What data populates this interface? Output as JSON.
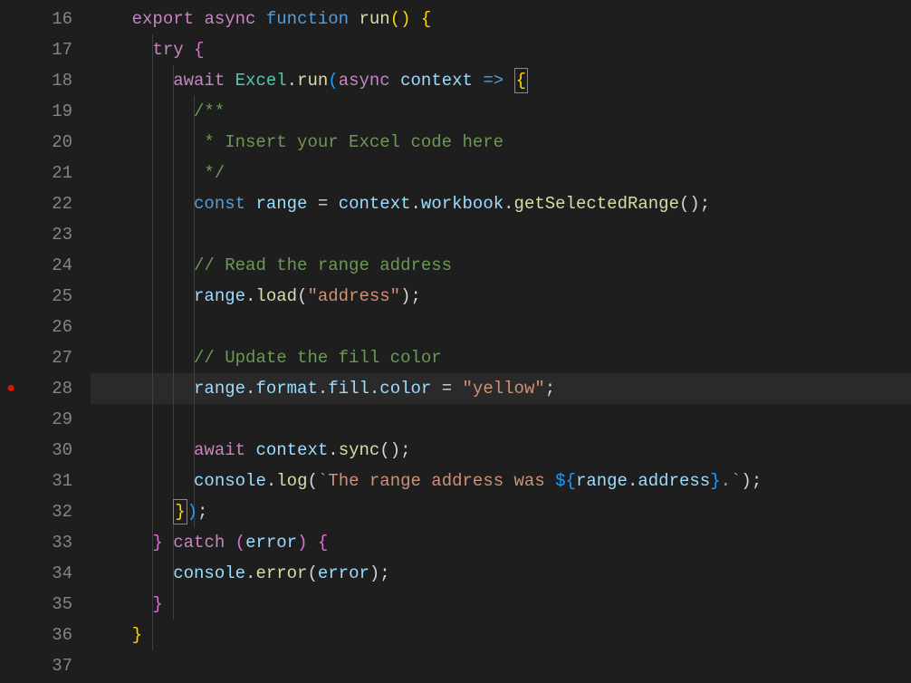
{
  "editor": {
    "startLine": 16,
    "endLine": 37,
    "breakpointLines": [
      28
    ],
    "currentLine": 28,
    "lines": [
      {
        "n": 16,
        "tokens": [
          {
            "t": "    ",
            "c": ""
          },
          {
            "t": "export",
            "c": "k-export"
          },
          {
            "t": " ",
            "c": ""
          },
          {
            "t": "async",
            "c": "k-async"
          },
          {
            "t": " ",
            "c": ""
          },
          {
            "t": "function",
            "c": "k-function"
          },
          {
            "t": " ",
            "c": ""
          },
          {
            "t": "run",
            "c": "fn-name"
          },
          {
            "t": "()",
            "c": "brace"
          },
          {
            "t": " ",
            "c": ""
          },
          {
            "t": "{",
            "c": "brace"
          }
        ]
      },
      {
        "n": 17,
        "tokens": [
          {
            "t": "      ",
            "c": ""
          },
          {
            "t": "try",
            "c": "k-try"
          },
          {
            "t": " ",
            "c": ""
          },
          {
            "t": "{",
            "c": "brace-pink"
          }
        ]
      },
      {
        "n": 18,
        "tokens": [
          {
            "t": "        ",
            "c": ""
          },
          {
            "t": "await",
            "c": "k-await"
          },
          {
            "t": " ",
            "c": ""
          },
          {
            "t": "Excel",
            "c": "cls"
          },
          {
            "t": ".",
            "c": "punct"
          },
          {
            "t": "run",
            "c": "method"
          },
          {
            "t": "(",
            "c": "brace-blue"
          },
          {
            "t": "async",
            "c": "k-async"
          },
          {
            "t": " ",
            "c": ""
          },
          {
            "t": "context",
            "c": "param"
          },
          {
            "t": " ",
            "c": ""
          },
          {
            "t": "=>",
            "c": "arrow"
          },
          {
            "t": " ",
            "c": ""
          },
          {
            "t": "{",
            "c": "brace",
            "box": true
          }
        ]
      },
      {
        "n": 19,
        "tokens": [
          {
            "t": "          ",
            "c": ""
          },
          {
            "t": "/**",
            "c": "comment"
          }
        ]
      },
      {
        "n": 20,
        "tokens": [
          {
            "t": "           ",
            "c": ""
          },
          {
            "t": "* Insert your Excel code here",
            "c": "comment"
          }
        ]
      },
      {
        "n": 21,
        "tokens": [
          {
            "t": "           ",
            "c": ""
          },
          {
            "t": "*/",
            "c": "comment"
          }
        ]
      },
      {
        "n": 22,
        "tokens": [
          {
            "t": "          ",
            "c": ""
          },
          {
            "t": "const",
            "c": "k-const"
          },
          {
            "t": " ",
            "c": ""
          },
          {
            "t": "range",
            "c": "var"
          },
          {
            "t": " = ",
            "c": "punct"
          },
          {
            "t": "context",
            "c": "param"
          },
          {
            "t": ".",
            "c": "punct"
          },
          {
            "t": "workbook",
            "c": "prop"
          },
          {
            "t": ".",
            "c": "punct"
          },
          {
            "t": "getSelectedRange",
            "c": "method"
          },
          {
            "t": "();",
            "c": "punct"
          }
        ]
      },
      {
        "n": 23,
        "tokens": []
      },
      {
        "n": 24,
        "tokens": [
          {
            "t": "          ",
            "c": ""
          },
          {
            "t": "// Read the range address",
            "c": "comment"
          }
        ]
      },
      {
        "n": 25,
        "tokens": [
          {
            "t": "          ",
            "c": ""
          },
          {
            "t": "range",
            "c": "var"
          },
          {
            "t": ".",
            "c": "punct"
          },
          {
            "t": "load",
            "c": "method"
          },
          {
            "t": "(",
            "c": "punct"
          },
          {
            "t": "\"address\"",
            "c": "string"
          },
          {
            "t": ");",
            "c": "punct"
          }
        ]
      },
      {
        "n": 26,
        "tokens": []
      },
      {
        "n": 27,
        "tokens": [
          {
            "t": "          ",
            "c": ""
          },
          {
            "t": "// Update the fill color",
            "c": "comment"
          }
        ]
      },
      {
        "n": 28,
        "tokens": [
          {
            "t": "          ",
            "c": ""
          },
          {
            "t": "range",
            "c": "var"
          },
          {
            "t": ".",
            "c": "punct"
          },
          {
            "t": "format",
            "c": "prop"
          },
          {
            "t": ".",
            "c": "punct"
          },
          {
            "t": "fill",
            "c": "prop"
          },
          {
            "t": ".",
            "c": "punct"
          },
          {
            "t": "color",
            "c": "prop"
          },
          {
            "t": " = ",
            "c": "punct"
          },
          {
            "t": "\"yellow\"",
            "c": "string"
          },
          {
            "t": ";",
            "c": "punct"
          }
        ]
      },
      {
        "n": 29,
        "tokens": []
      },
      {
        "n": 30,
        "tokens": [
          {
            "t": "          ",
            "c": ""
          },
          {
            "t": "await",
            "c": "k-await"
          },
          {
            "t": " ",
            "c": ""
          },
          {
            "t": "context",
            "c": "param"
          },
          {
            "t": ".",
            "c": "punct"
          },
          {
            "t": "sync",
            "c": "method"
          },
          {
            "t": "();",
            "c": "punct"
          }
        ]
      },
      {
        "n": 31,
        "tokens": [
          {
            "t": "          ",
            "c": ""
          },
          {
            "t": "console",
            "c": "var"
          },
          {
            "t": ".",
            "c": "punct"
          },
          {
            "t": "log",
            "c": "method"
          },
          {
            "t": "(",
            "c": "punct"
          },
          {
            "t": "`The range address was ",
            "c": "string"
          },
          {
            "t": "${",
            "c": "brace-blue"
          },
          {
            "t": "range",
            "c": "var"
          },
          {
            "t": ".",
            "c": "punct"
          },
          {
            "t": "address",
            "c": "prop"
          },
          {
            "t": "}",
            "c": "brace-blue"
          },
          {
            "t": ".`",
            "c": "string"
          },
          {
            "t": ");",
            "c": "punct"
          }
        ]
      },
      {
        "n": 32,
        "tokens": [
          {
            "t": "        ",
            "c": ""
          },
          {
            "t": "}",
            "c": "brace",
            "box": true
          },
          {
            "t": ")",
            "c": "brace-blue"
          },
          {
            "t": ";",
            "c": "punct"
          }
        ]
      },
      {
        "n": 33,
        "tokens": [
          {
            "t": "      ",
            "c": ""
          },
          {
            "t": "}",
            "c": "brace-pink"
          },
          {
            "t": " ",
            "c": ""
          },
          {
            "t": "catch",
            "c": "k-catch"
          },
          {
            "t": " ",
            "c": ""
          },
          {
            "t": "(",
            "c": "brace-pink"
          },
          {
            "t": "error",
            "c": "param"
          },
          {
            "t": ")",
            "c": "brace-pink"
          },
          {
            "t": " ",
            "c": ""
          },
          {
            "t": "{",
            "c": "brace-pink"
          }
        ]
      },
      {
        "n": 34,
        "tokens": [
          {
            "t": "        ",
            "c": ""
          },
          {
            "t": "console",
            "c": "var"
          },
          {
            "t": ".",
            "c": "punct"
          },
          {
            "t": "error",
            "c": "method"
          },
          {
            "t": "(",
            "c": "punct"
          },
          {
            "t": "error",
            "c": "param"
          },
          {
            "t": ");",
            "c": "punct"
          }
        ]
      },
      {
        "n": 35,
        "tokens": [
          {
            "t": "      ",
            "c": ""
          },
          {
            "t": "}",
            "c": "brace-pink"
          }
        ]
      },
      {
        "n": 36,
        "tokens": [
          {
            "t": "    ",
            "c": ""
          },
          {
            "t": "}",
            "c": "brace"
          }
        ]
      },
      {
        "n": 37,
        "tokens": []
      }
    ]
  }
}
